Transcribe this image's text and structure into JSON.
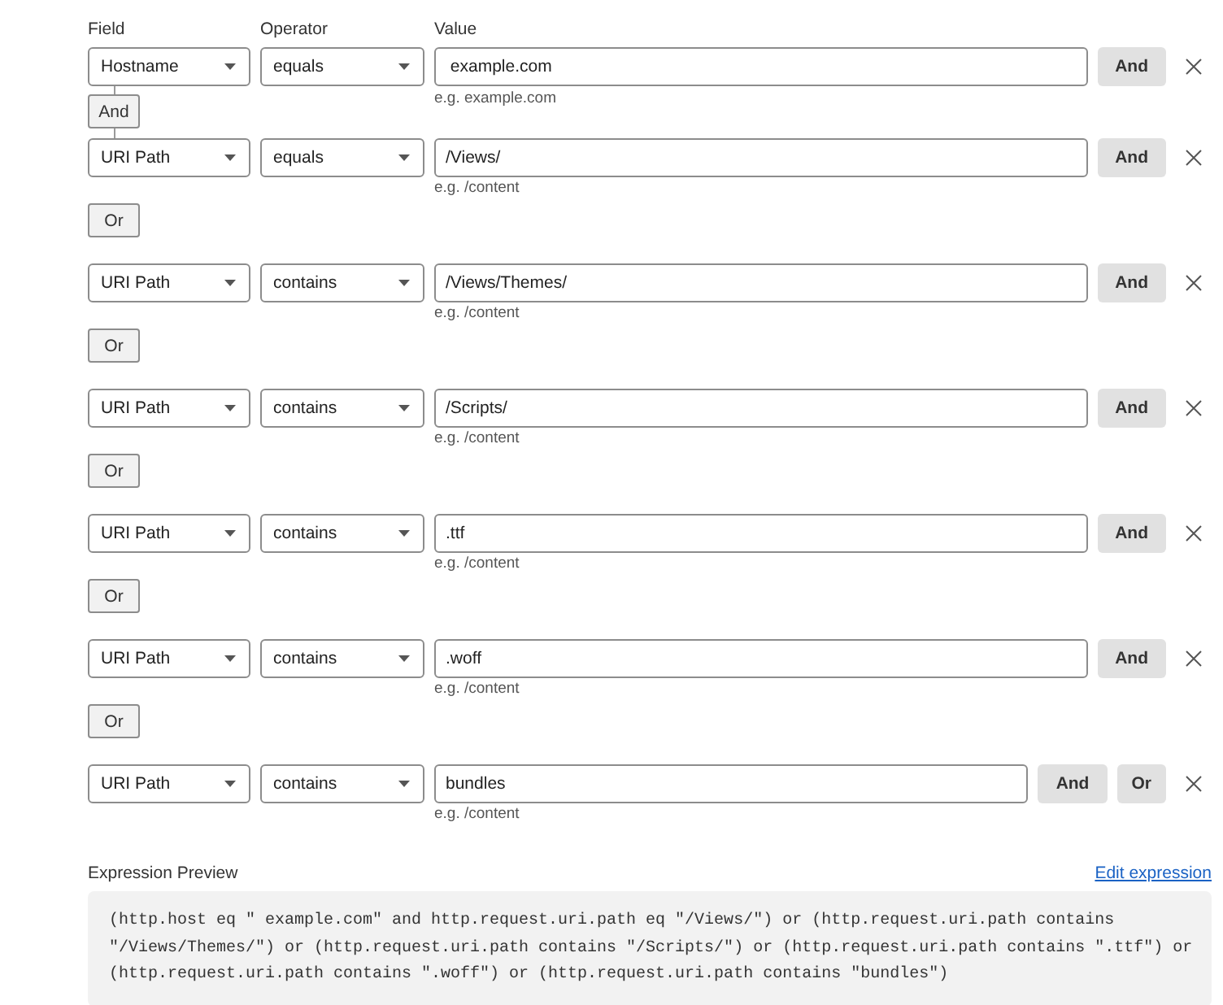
{
  "columns": [
    "Field",
    "Operator",
    "Value"
  ],
  "conditions": [
    {
      "field": "Hostname",
      "operator": "equals",
      "value": " example.com",
      "hint": "e.g. example.com",
      "buttons": [
        "And"
      ],
      "connector": {
        "kind": "and",
        "label": "And"
      }
    },
    {
      "field": "URI Path",
      "operator": "equals",
      "value": "/Views/",
      "hint": "e.g. /content",
      "buttons": [
        "And"
      ],
      "connector": {
        "kind": "or",
        "label": "Or"
      }
    },
    {
      "field": "URI Path",
      "operator": "contains",
      "value": "/Views/Themes/",
      "hint": "e.g. /content",
      "buttons": [
        "And"
      ],
      "connector": {
        "kind": "or",
        "label": "Or"
      }
    },
    {
      "field": "URI Path",
      "operator": "contains",
      "value": "/Scripts/",
      "hint": "e.g. /content",
      "buttons": [
        "And"
      ],
      "connector": {
        "kind": "or",
        "label": "Or"
      }
    },
    {
      "field": "URI Path",
      "operator": "contains",
      "value": ".ttf",
      "hint": "e.g. /content",
      "buttons": [
        "And"
      ],
      "connector": {
        "kind": "or",
        "label": "Or"
      }
    },
    {
      "field": "URI Path",
      "operator": "contains",
      "value": ".woff",
      "hint": "e.g. /content",
      "buttons": [
        "And"
      ],
      "connector": {
        "kind": "or",
        "label": "Or"
      }
    },
    {
      "field": "URI Path",
      "operator": "contains",
      "value": "bundles",
      "hint": "e.g. /content",
      "buttons": [
        "And",
        "Or"
      ]
    }
  ],
  "expression_preview": {
    "label": "Expression Preview",
    "link": "Edit expression",
    "text": "(http.host eq \" example.com\" and http.request.uri.path eq \"/Views/\") or (http.request.uri.path contains \"/Views/Themes/\") or (http.request.uri.path contains \"/Scripts/\") or (http.request.uri.path contains \".ttf\") or (http.request.uri.path contains \".woff\") or (http.request.uri.path contains \"bundles\")"
  }
}
